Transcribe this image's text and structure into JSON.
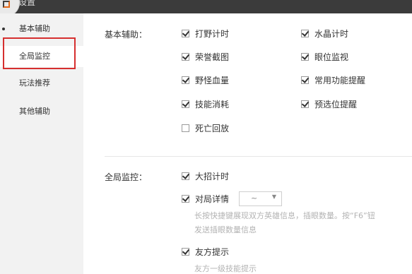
{
  "window": {
    "title": "设置"
  },
  "sidebar": {
    "items": [
      {
        "label": "基本辅助"
      },
      {
        "label": "全局监控"
      },
      {
        "label": "玩法推荐"
      },
      {
        "label": "其他辅助"
      }
    ]
  },
  "basic": {
    "section_label": "基本辅助：",
    "options": [
      {
        "label": "打野计时",
        "checked": true
      },
      {
        "label": "水晶计时",
        "checked": true
      },
      {
        "label": "荣誉截图",
        "checked": true
      },
      {
        "label": "眼位监视",
        "checked": true
      },
      {
        "label": "野怪血量",
        "checked": true
      },
      {
        "label": "常用功能提醒",
        "checked": true
      },
      {
        "label": "技能消耗",
        "checked": true
      },
      {
        "label": "预选位提醒",
        "checked": true
      },
      {
        "label": "死亡回放",
        "checked": false
      }
    ]
  },
  "global": {
    "section_label": "全局监控：",
    "options": [
      {
        "label": "大招计时",
        "checked": true
      },
      {
        "label": "对局详情",
        "checked": true
      },
      {
        "label": "友方提示",
        "checked": true
      }
    ],
    "detail_select_value": "~",
    "detail_hint_line1": "长按快捷键展现双方英雄信息，插眼数量。按“F6”钮",
    "detail_hint_line2": "发送插眼数量信息",
    "friend_hint": "友方一级技能提示"
  }
}
